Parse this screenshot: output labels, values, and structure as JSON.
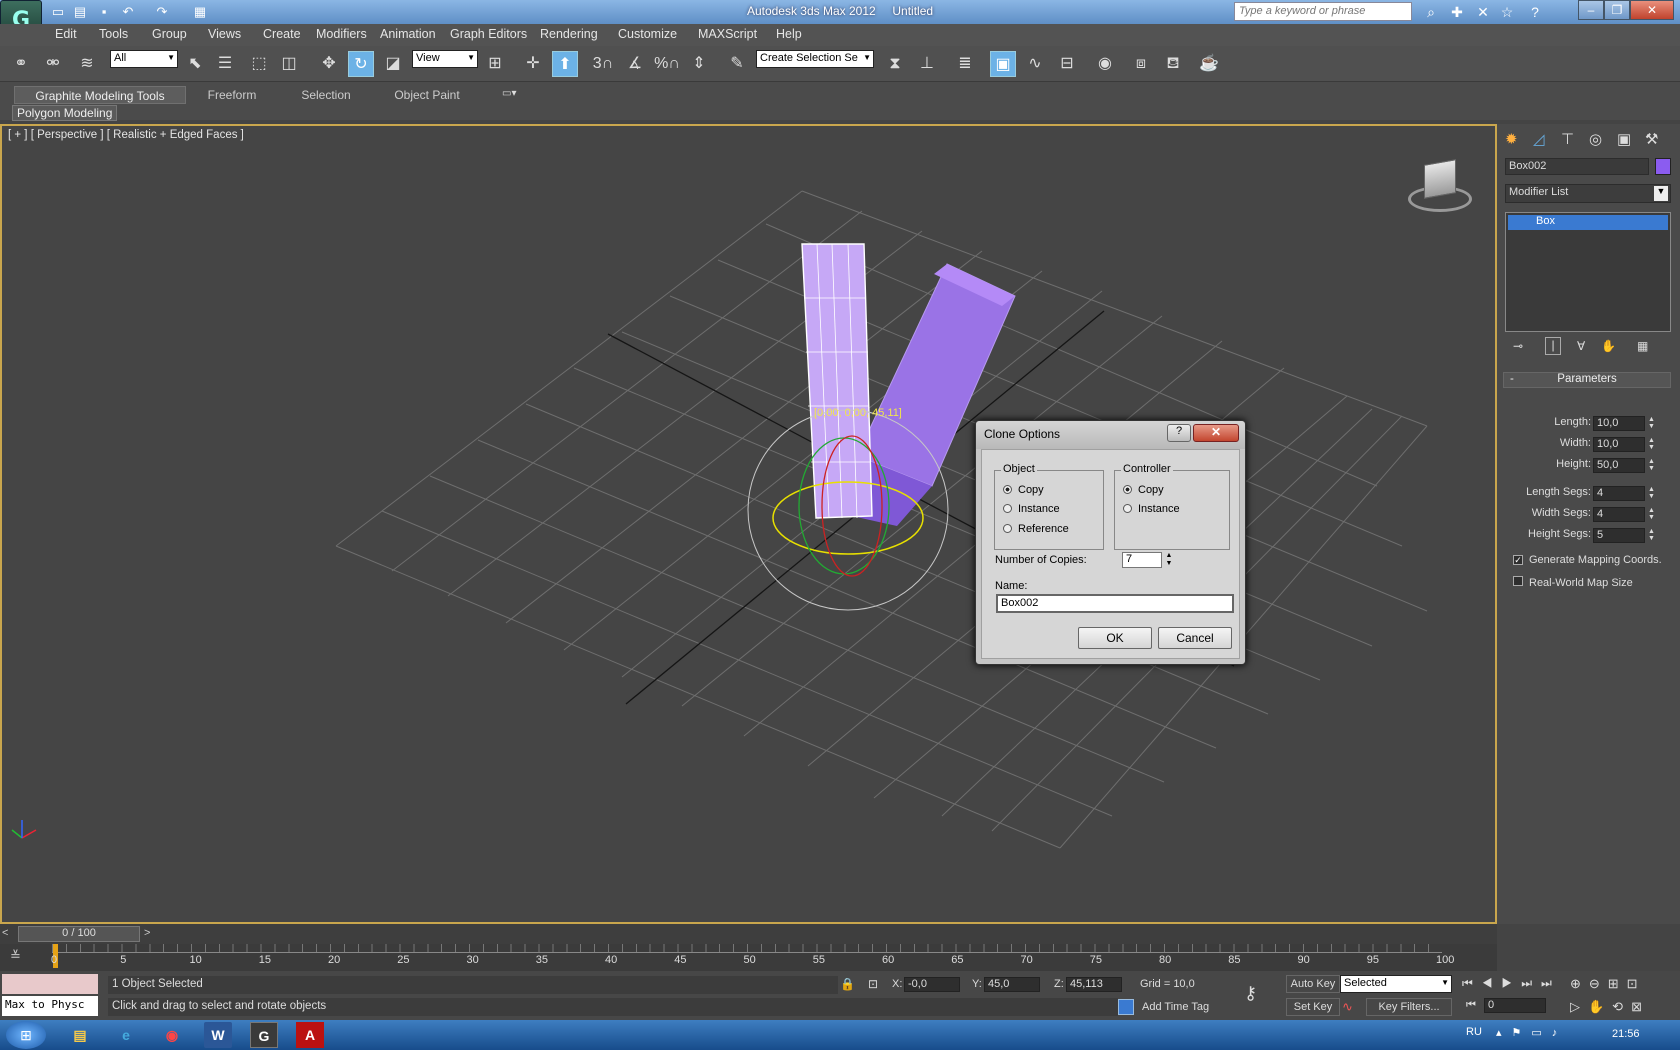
{
  "app": {
    "title": "Autodesk 3ds Max 2012",
    "document": "Untitled",
    "logo": "3ds-max-logo",
    "search_placeholder": "Type a keyword or phrase"
  },
  "menu": [
    "Edit",
    "Tools",
    "Group",
    "Views",
    "Create",
    "Modifiers",
    "Animation",
    "Graph Editors",
    "Rendering",
    "Customize",
    "MAXScript",
    "Help"
  ],
  "toolbar": {
    "selection_filter": "All",
    "ref_coord": "View",
    "selection_set": "Create Selection Se",
    "snap_labels": [
      "3",
      "%"
    ]
  },
  "ribbon": {
    "tabs": [
      "Graphite Modeling Tools",
      "Freeform",
      "Selection",
      "Object Paint"
    ],
    "active_tab": "Graphite Modeling Tools",
    "panel": "Polygon Modeling"
  },
  "viewport": {
    "label": "[ + ] [ Perspective ] [ Realistic + Edged Faces ]",
    "rotate_readout": "[0,00, 0,00, 45,11]"
  },
  "command_panel": {
    "object_name": "Box002",
    "object_color": "#8b5cf0",
    "modifier_list": "Modifier List",
    "stack_item": "Box",
    "rollout_title": "Parameters",
    "params": [
      {
        "label": "Length:",
        "value": "10,0"
      },
      {
        "label": "Width:",
        "value": "10,0"
      },
      {
        "label": "Height:",
        "value": "50,0"
      },
      {
        "label": "Length Segs:",
        "value": "4"
      },
      {
        "label": "Width Segs:",
        "value": "4"
      },
      {
        "label": "Height Segs:",
        "value": "5"
      }
    ],
    "checkboxes": [
      {
        "label": "Generate Mapping Coords.",
        "checked": true
      },
      {
        "label": "Real-World Map Size",
        "checked": false
      }
    ]
  },
  "dialog": {
    "title": "Clone Options",
    "object_group": "Object",
    "object_options": [
      "Copy",
      "Instance",
      "Reference"
    ],
    "object_selected": "Copy",
    "controller_group": "Controller",
    "controller_options": [
      "Copy",
      "Instance"
    ],
    "controller_selected": "Copy",
    "copies_label": "Number of Copies:",
    "copies_value": "7",
    "name_label": "Name:",
    "name_value": "Box002",
    "ok": "OK",
    "cancel": "Cancel"
  },
  "timeline": {
    "frame_readout": "0 / 100",
    "ticks": [
      "0",
      "5",
      "10",
      "15",
      "20",
      "25",
      "30",
      "35",
      "40",
      "45",
      "50",
      "55",
      "60",
      "65",
      "70",
      "75",
      "80",
      "85",
      "90",
      "95",
      "100"
    ]
  },
  "status": {
    "maxscript_listener": "Max to Physc",
    "selection": "1 Object Selected",
    "prompt": "Click and drag to select and rotate objects",
    "x": "-0,0",
    "y": "45,0",
    "z": "45,113",
    "grid": "Grid = 10,0",
    "add_time_tag": "Add Time Tag",
    "auto_key": "Auto Key",
    "set_key": "Set Key",
    "key_mode": "Selected",
    "key_filters": "Key Filters...",
    "frame": "0"
  },
  "taskbar": {
    "lang": "RU",
    "time": "21:56",
    "apps": [
      "explorer",
      "ie",
      "chrome",
      "word",
      "3dsmax",
      "acrobat"
    ]
  }
}
